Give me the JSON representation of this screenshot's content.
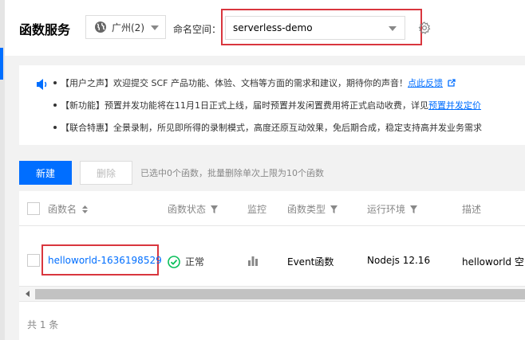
{
  "header": {
    "title": "函数服务",
    "region": {
      "label": "广州(2)",
      "icon": "globe-icon"
    },
    "namespace": {
      "label": "命名空间：",
      "value": "serverless-demo"
    },
    "settings_icon": "gear-icon"
  },
  "notice": {
    "icon": "speaker-icon",
    "items": [
      {
        "text": "【用户之声】欢迎提交 SCF 产品功能、体验、文档等方面的需求和建议，期待你的声音！",
        "link": "点此反馈"
      },
      {
        "text": "【新功能】预置并发功能将在11月1日正式上线，届时预置并发闲置费用将正式启动收费，详见",
        "link": "预置并发定价"
      },
      {
        "text": "【联合特惠】全景录制，所见即所得的录制模式，高度还原互动效果，免后期合成，稳定支持高并发业务需求"
      }
    ]
  },
  "toolbar": {
    "new_label": "新建",
    "delete_label": "删除",
    "hint": "已选中0个函数，批量删除单次上限为10个函数"
  },
  "table": {
    "columns": [
      "函数名",
      "函数状态",
      "监控",
      "函数类型",
      "运行环境",
      "描述"
    ],
    "rows": [
      {
        "name": "helloworld-1636198529",
        "status": "正常",
        "type": "Event函数",
        "runtime": "Nodejs 12.16",
        "desc": "helloworld 空白模板函数"
      }
    ],
    "total": "共 1 条"
  },
  "colors": {
    "accent": "#006eff",
    "highlight": "#d9363e",
    "success": "#0abf5b"
  }
}
